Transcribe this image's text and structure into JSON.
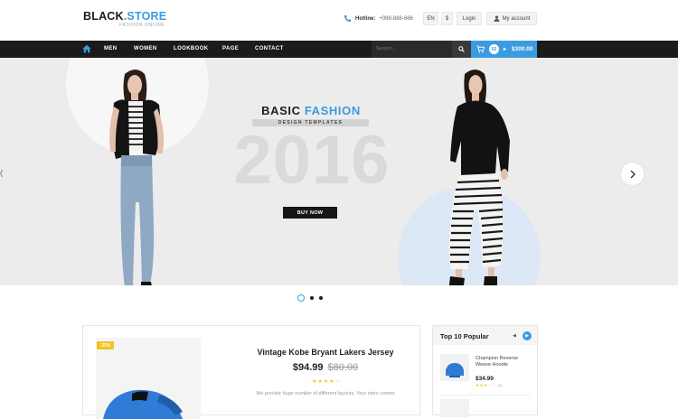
{
  "header": {
    "logo_main": "BLACK",
    "logo_accent": ".STORE",
    "logo_tagline": "FASHION ONLINE",
    "hotline_label": "Hotline:",
    "hotline_number": "+098-888-666",
    "language": "EN",
    "currency": "$",
    "login_label": "Login",
    "account_label": "My account"
  },
  "nav": {
    "items": [
      "MEN",
      "WOMEN",
      "LOOKBOOK",
      "PAGE",
      "CONTACT"
    ],
    "search_placeholder": "Search...",
    "cart_count": "02",
    "cart_total": "$300.00"
  },
  "hero": {
    "title_main": "BASIC ",
    "title_accent": "FASHION",
    "subtitle": "DESIGN TEMPLATES",
    "year": "2016",
    "cta_label": "BUY NOW",
    "slide_count": 3,
    "active_slide": 1
  },
  "featured_product": {
    "badge": "-35%",
    "name": "Vintage Kobe Bryant Lakers Jersey",
    "price": "$94.99",
    "old_price": "$80.00",
    "rating": 4,
    "rating_max": 5,
    "description": "We provide huge number of different layouts. Your store comes"
  },
  "popular": {
    "title": "Top 10 Popular",
    "items": [
      {
        "name": "Champion Reverse Weave Hoodie",
        "price": "$34.99",
        "rating": 3,
        "reviews": "(2)"
      }
    ]
  },
  "colors": {
    "accent": "#3b9be0",
    "dark": "#1b1b1b",
    "star": "#f6c21c"
  }
}
